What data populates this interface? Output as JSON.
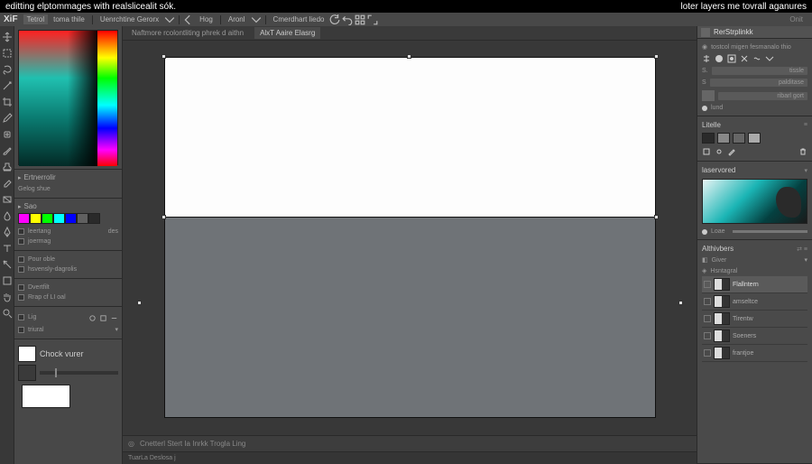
{
  "title_left": "editting elptommages with realslicealit sók.",
  "title_right": "loter layers me tovrall aganures",
  "menu": {
    "logo": "XiF",
    "items": [
      "Tetrol",
      "toma thile"
    ],
    "group2": [
      "Uenrchtine Gerorx"
    ],
    "group3": [
      "Hog"
    ],
    "group4": [
      "Aronl"
    ],
    "group5": [
      "Cmerdhart liedo"
    ],
    "right_label": "Onit"
  },
  "tabs": {
    "t1": "Naftmore rcolontliting phrek d aithn",
    "t2": "AlxT Aaire Elasrg"
  },
  "left": {
    "sec1_title": "Ertnerrolir",
    "sec1_sub": "Gelog shue",
    "sec2_title": "Sao",
    "swatches": [
      "#ff00ff",
      "#ffff00",
      "#00ff00",
      "#00ffff",
      "#0000ff",
      "#606060",
      "#2a2a2a"
    ],
    "rows": [
      "leertang",
      "joermag",
      "Pour oble",
      "hsvensly-dagrolis",
      "Dvertfilt",
      "Rrap cf LI oal"
    ],
    "row_des": "des",
    "sec3_l": "Lig",
    "sec3_r": "triural",
    "chock": "Chock vurer"
  },
  "right": {
    "header": "RerStrplinkk",
    "sub": "tostcol migen fesmanalo thio",
    "opt1": "tissle",
    "opt2": "palditase",
    "opt3": "ribarl gort",
    "opt4": "lund",
    "panel2": "Litelle",
    "panel2_swatches": [
      "#2a2a2a",
      "#888",
      "#666",
      "#aaa"
    ],
    "panel3": "laservored",
    "panel3_slider": "Loae",
    "panel4": "Althivbers",
    "panel4_r1": "Giver",
    "panel4_r2": "Hsntagral",
    "layers": [
      "Flallntern",
      "amseltce",
      "Tirentw",
      "Soeners",
      "frantjoe"
    ]
  },
  "status": {
    "hint": "Cnetterl Stert Ia Inrkk Trogla Ling",
    "footer": "TuarLa Deslosa j"
  },
  "tools": [
    "move",
    "select",
    "lasso",
    "wand",
    "crop",
    "eyedrop",
    "heal",
    "brush",
    "stamp",
    "eraser",
    "gradient",
    "blur",
    "pen",
    "text",
    "path",
    "shape",
    "hand",
    "zoom"
  ]
}
